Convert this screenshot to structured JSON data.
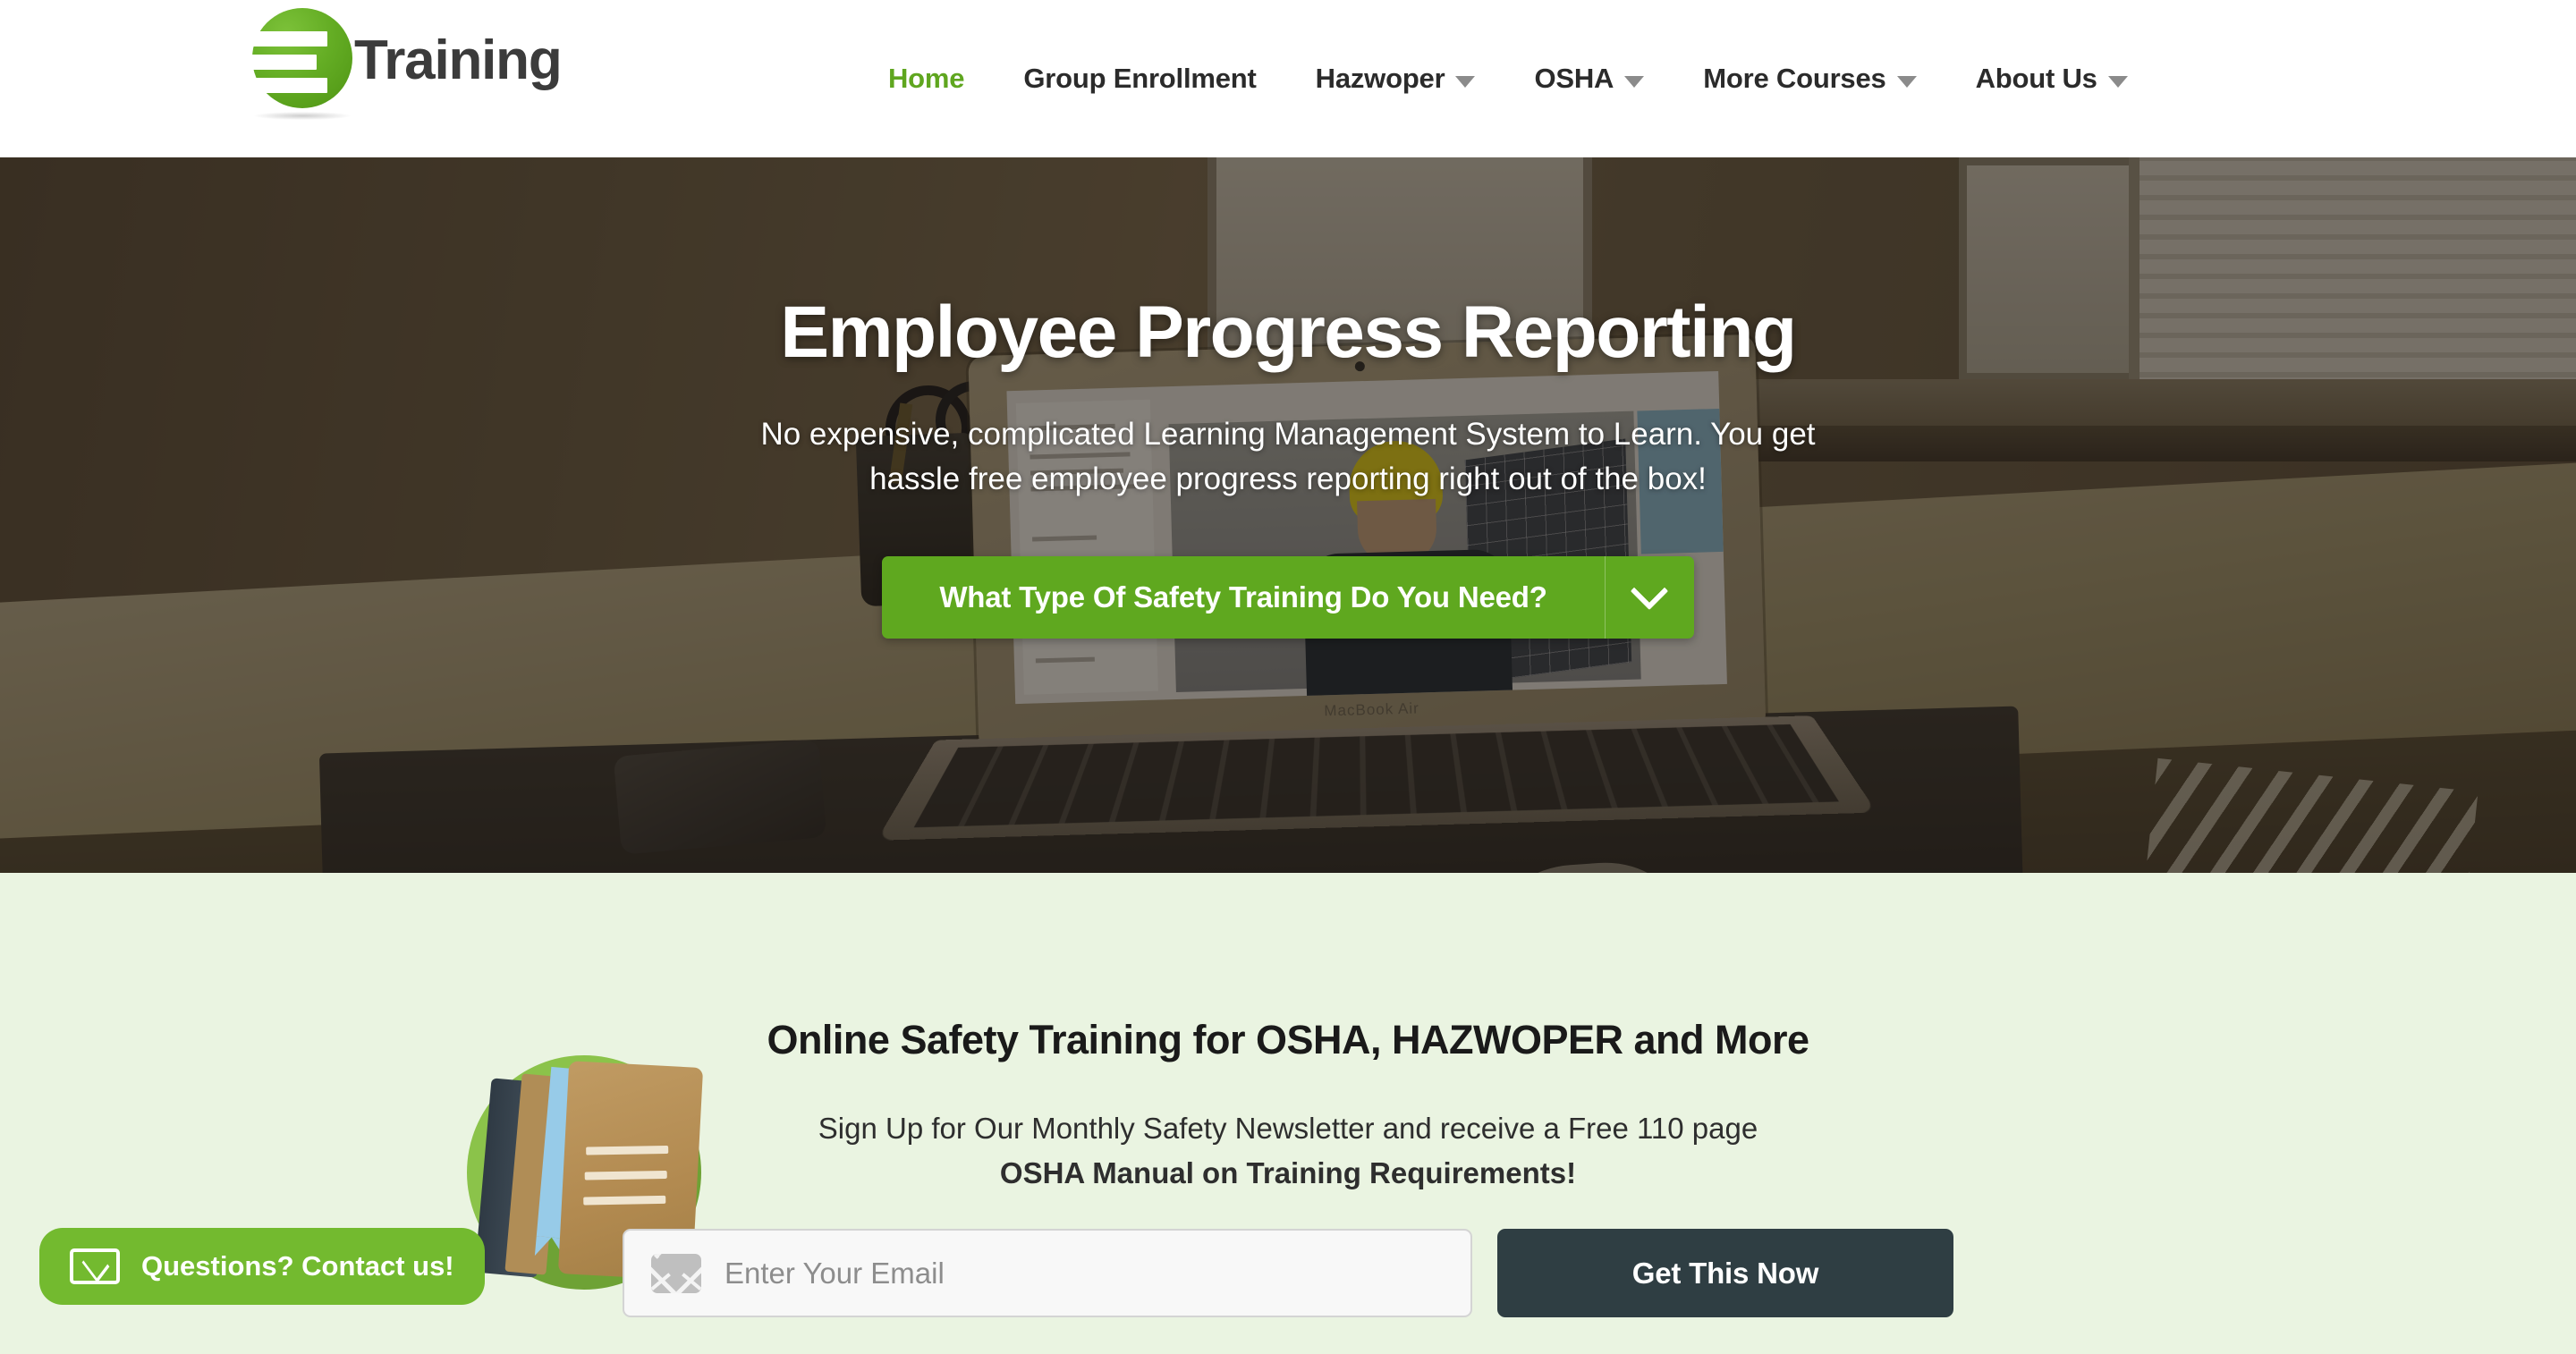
{
  "header": {
    "brand": {
      "word": "Training",
      "logo_icon": "three-bars-disc-logo"
    },
    "nav": [
      {
        "label": "Home",
        "has_dropdown": false,
        "active": true
      },
      {
        "label": "Group Enrollment",
        "has_dropdown": false,
        "active": false
      },
      {
        "label": "Hazwoper",
        "has_dropdown": true,
        "active": false
      },
      {
        "label": "OSHA",
        "has_dropdown": true,
        "active": false
      },
      {
        "label": "More Courses",
        "has_dropdown": true,
        "active": false
      },
      {
        "label": "About Us",
        "has_dropdown": true,
        "active": false
      }
    ]
  },
  "hero": {
    "title": "Employee Progress Reporting",
    "subtitle": "No expensive, complicated Learning Management System to Learn. You get hassle free employee progress reporting right out of the box!",
    "cta_label": "What Type Of Safety Training Do You Need?",
    "cta_icon": "chevron-down-icon",
    "laptop_brand": "MacBook Air"
  },
  "newsletter": {
    "heading": "Online Safety Training for OSHA, HAZWOPER and More",
    "sub_line1": "Sign Up for Our Monthly Safety Newsletter and receive a Free 110 page",
    "sub_line2": "OSHA Manual on Training Requirements!",
    "email_placeholder": "Enter Your Email",
    "email_value": "",
    "email_icon": "envelope-icon",
    "submit_label": "Get This Now",
    "book_icon": "book-illustration"
  },
  "contact_tab": {
    "label": "Questions? Contact us!",
    "icon": "envelope-icon"
  },
  "colors": {
    "brand_green": "#5fa81f",
    "nav_active_green": "#5fa61f",
    "contact_green": "#73ba2f",
    "dark_slate": "#2f3e43",
    "mint_bg": "#eaf4e1",
    "header_bg": "#ffffff"
  }
}
